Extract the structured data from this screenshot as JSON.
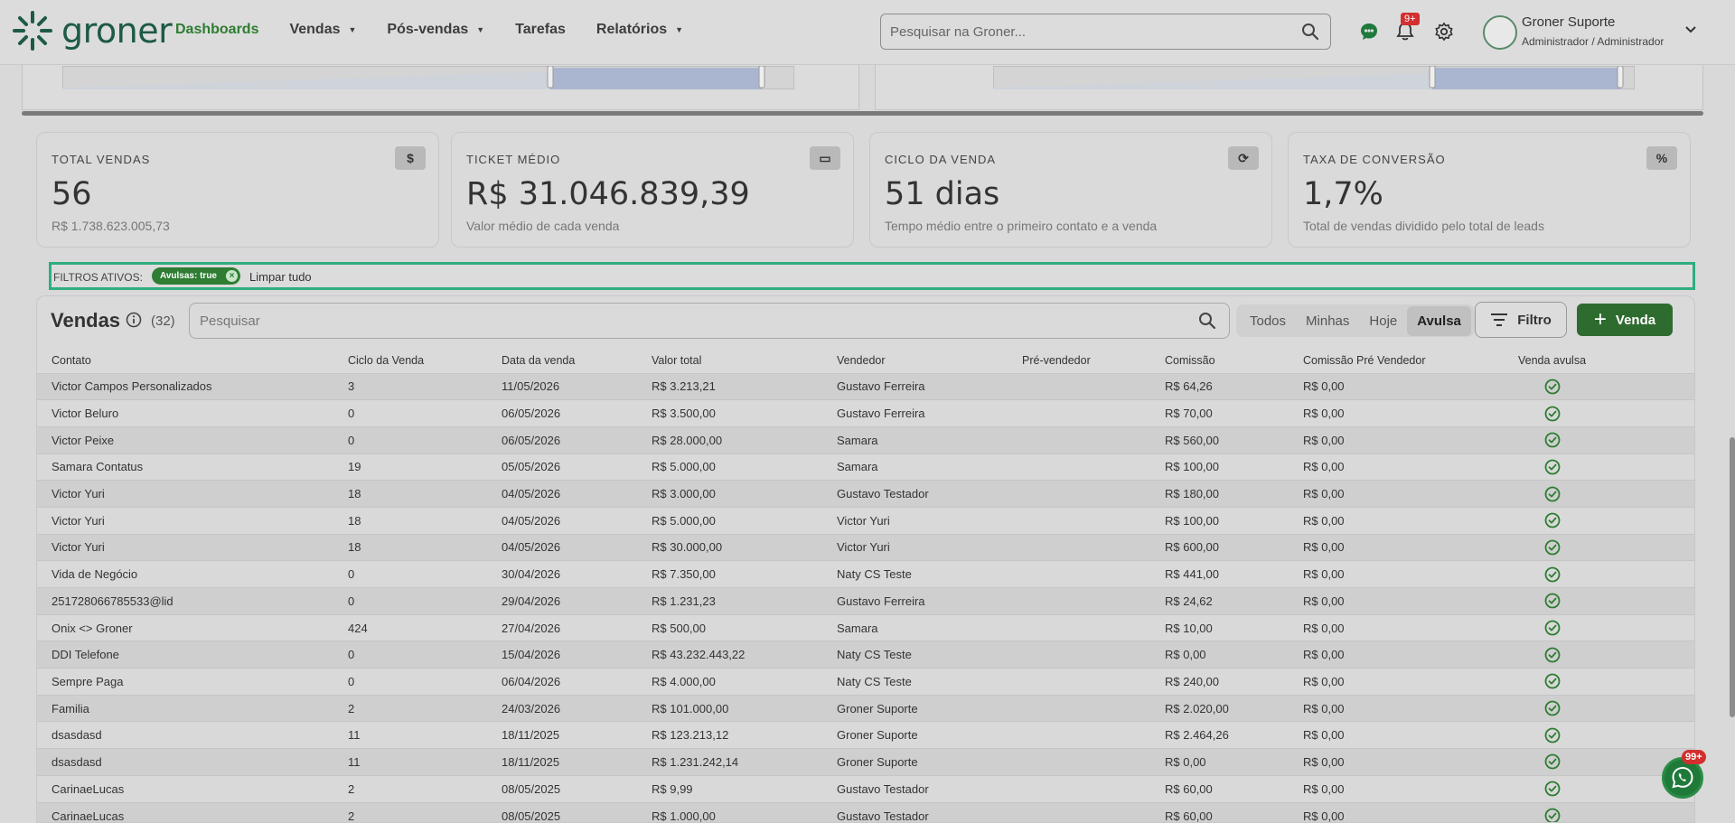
{
  "header": {
    "logo_text": "groner",
    "nav": [
      {
        "label": "Dashboards",
        "active": true,
        "caret": false
      },
      {
        "label": "Vendas",
        "active": false,
        "caret": true
      },
      {
        "label": "Pós-vendas",
        "active": false,
        "caret": true
      },
      {
        "label": "Tarefas",
        "active": false,
        "caret": false
      },
      {
        "label": "Relatórios",
        "active": false,
        "caret": true
      }
    ],
    "search_placeholder": "Pesquisar na Groner...",
    "notification_badge": "9+",
    "user_name": "Groner Suporte",
    "user_role": "Administrador / Administrador"
  },
  "stats": [
    {
      "label": "TOTAL VENDAS",
      "value": "56",
      "sub": "R$ 1.738.623.005,73",
      "icon": "dollar-icon"
    },
    {
      "label": "TICKET MÉDIO",
      "value": "R$ 31.046.839,39",
      "sub": "Valor médio de cada venda",
      "icon": "ticket-icon"
    },
    {
      "label": "CICLO DA VENDA",
      "value": "51 dias",
      "sub": "Tempo médio entre o primeiro contato e a venda",
      "icon": "cycle-icon"
    },
    {
      "label": "TAXA DE CONVERSÃO",
      "value": "1,7%",
      "sub": "Total de vendas dividido pelo total de leads",
      "icon": "percent-icon"
    }
  ],
  "filters": {
    "label": "FILTROS ATIVOS:",
    "chip": "Avulsas: true",
    "clear": "Limpar tudo"
  },
  "sales": {
    "title": "Vendas",
    "count": "(32)",
    "search_placeholder": "Pesquisar",
    "segments": [
      {
        "label": "Todos",
        "active": false
      },
      {
        "label": "Minhas",
        "active": false
      },
      {
        "label": "Hoje",
        "active": false
      },
      {
        "label": "Avulsa",
        "active": true
      }
    ],
    "filter_button": "Filtro",
    "new_button": "Venda",
    "columns": [
      "Contato",
      "Ciclo da Venda",
      "Data da venda",
      "Valor total",
      "Vendedor",
      "Pré-vendedor",
      "Comissão",
      "Comissão Pré Vendedor",
      "Venda avulsa"
    ],
    "rows": [
      [
        "Victor Campos Personalizados",
        "3",
        "11/05/2026",
        "R$ 3.213,21",
        "Gustavo Ferreira",
        "",
        "R$ 64,26",
        "R$ 0,00"
      ],
      [
        "Victor Beluro",
        "0",
        "06/05/2026",
        "R$ 3.500,00",
        "Gustavo Ferreira",
        "",
        "R$ 70,00",
        "R$ 0,00"
      ],
      [
        "Victor Peixe",
        "0",
        "06/05/2026",
        "R$ 28.000,00",
        "Samara",
        "",
        "R$ 560,00",
        "R$ 0,00"
      ],
      [
        "Samara Contatus",
        "19",
        "05/05/2026",
        "R$ 5.000,00",
        "Samara",
        "",
        "R$ 100,00",
        "R$ 0,00"
      ],
      [
        "Victor Yuri",
        "18",
        "04/05/2026",
        "R$ 3.000,00",
        "Gustavo Testador",
        "",
        "R$ 180,00",
        "R$ 0,00"
      ],
      [
        "Victor Yuri",
        "18",
        "04/05/2026",
        "R$ 5.000,00",
        "Victor Yuri",
        "",
        "R$ 100,00",
        "R$ 0,00"
      ],
      [
        "Victor Yuri",
        "18",
        "04/05/2026",
        "R$ 30.000,00",
        "Victor Yuri",
        "",
        "R$ 600,00",
        "R$ 0,00"
      ],
      [
        "Vida de Negócio",
        "0",
        "30/04/2026",
        "R$ 7.350,00",
        "Naty CS Teste",
        "",
        "R$ 441,00",
        "R$ 0,00"
      ],
      [
        "251728066785533@lid",
        "0",
        "29/04/2026",
        "R$ 1.231,23",
        "Gustavo Ferreira",
        "",
        "R$ 24,62",
        "R$ 0,00"
      ],
      [
        "Onix <> Groner",
        "424",
        "27/04/2026",
        "R$ 500,00",
        "Samara",
        "",
        "R$ 10,00",
        "R$ 0,00"
      ],
      [
        "DDI Telefone",
        "0",
        "15/04/2026",
        "R$ 43.232.443,22",
        "Naty CS Teste",
        "",
        "R$ 0,00",
        "R$ 0,00"
      ],
      [
        "Sempre Paga",
        "0",
        "06/04/2026",
        "R$ 4.000,00",
        "Naty CS Teste",
        "",
        "R$ 240,00",
        "R$ 0,00"
      ],
      [
        "Familia",
        "2",
        "24/03/2026",
        "R$ 101.000,00",
        "Groner Suporte",
        "",
        "R$ 2.020,00",
        "R$ 0,00"
      ],
      [
        "dsasdasd",
        "11",
        "18/11/2025",
        "R$ 123.213,12",
        "Groner Suporte",
        "",
        "R$ 2.464,26",
        "R$ 0,00"
      ],
      [
        "dsasdasd",
        "11",
        "18/11/2025",
        "R$ 1.231.242,14",
        "Groner Suporte",
        "",
        "R$ 0,00",
        "R$ 0,00"
      ],
      [
        "CarinaeLucas",
        "2",
        "08/05/2025",
        "R$ 9,99",
        "Gustavo Testador",
        "",
        "R$ 60,00",
        "R$ 0,00"
      ],
      [
        "CarinaeLucas",
        "2",
        "08/05/2025",
        "R$ 1.000,00",
        "Gustavo Testador",
        "",
        "R$ 60,00",
        "R$ 0,00"
      ]
    ]
  },
  "whatsapp_badge": "99+",
  "colors": {
    "accent": "#2e7d32",
    "filter_border": "#2fae7f",
    "badge": "#d32f2f"
  }
}
